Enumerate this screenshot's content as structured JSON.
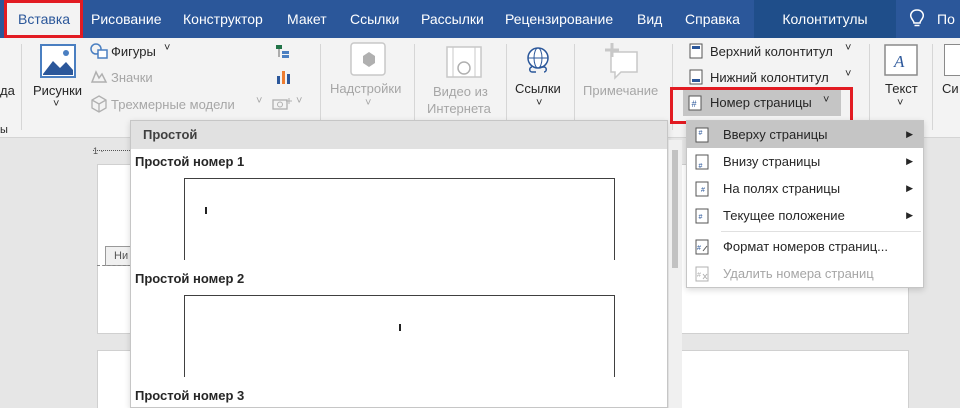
{
  "tabs": [
    {
      "id": "insert",
      "label": "Вставка"
    },
    {
      "id": "draw",
      "label": "Рисование"
    },
    {
      "id": "design",
      "label": "Конструктор"
    },
    {
      "id": "layout",
      "label": "Макет"
    },
    {
      "id": "references",
      "label": "Ссылки"
    },
    {
      "id": "mailings",
      "label": "Рассылки"
    },
    {
      "id": "review",
      "label": "Рецензирование"
    },
    {
      "id": "view",
      "label": "Вид"
    },
    {
      "id": "help",
      "label": "Справка"
    }
  ],
  "context_tab": "Колонтитулы",
  "tell_me_partial": "По",
  "ribbon": {
    "cut_left_label": "да",
    "cut_left_label2": "ы",
    "pictures": "Рисунки",
    "shapes": "Фигуры",
    "icons": "Значки",
    "models_3d": "Трехмерные модели",
    "addins": "Надстройки",
    "video_line1": "Видео из",
    "video_line2": "Интернета",
    "links": "Ссылки",
    "comment": "Примечание",
    "header": "Верхний колонтитул",
    "footer": "Нижний колонтитул",
    "page_number": "Номер страницы",
    "text": "Текст",
    "cut_right": "Си",
    "dropdown_chevron": "˅"
  },
  "gallery": {
    "header": "Простой",
    "items": [
      "Простой номер 1",
      "Простой номер 2",
      "Простой номер 3"
    ]
  },
  "doc_tab_partial": "Ни",
  "ruler_marker": "1 ·",
  "submenu": {
    "items": [
      {
        "label": "Вверху страницы",
        "has_arrow": true,
        "highlighted": true
      },
      {
        "label": "Внизу страницы",
        "has_arrow": true
      },
      {
        "label": "На полях страницы",
        "has_arrow": true
      },
      {
        "label": "Текущее положение",
        "has_arrow": true
      },
      {
        "label": "Формат номеров страниц...",
        "has_arrow": false
      },
      {
        "label": "Удалить номера страниц",
        "has_arrow": false,
        "disabled": true
      }
    ],
    "arrow": "▶"
  },
  "colors": {
    "tab_bar": "#2b579a",
    "highlight_box": "#e21b22",
    "ribbon_bg": "#f3f3f3"
  }
}
